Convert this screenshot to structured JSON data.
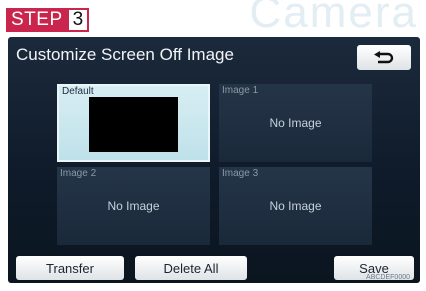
{
  "step": {
    "label": "STEP",
    "number": "3",
    "color": "#c9254d"
  },
  "background_word": "Camera",
  "screen": {
    "title": "Customize Screen Off Image",
    "back_button_icon": "return-arrow-icon",
    "tiles": [
      {
        "label": "Default",
        "text": "",
        "selected": true
      },
      {
        "label": "Image 1",
        "text": "No Image",
        "selected": false
      },
      {
        "label": "Image 2",
        "text": "No Image",
        "selected": false
      },
      {
        "label": "Image 3",
        "text": "No Image",
        "selected": false
      }
    ],
    "buttons": {
      "transfer": "Transfer",
      "delete_all": "Delete All",
      "save": "Save"
    },
    "code": "ABCDEF0000"
  }
}
